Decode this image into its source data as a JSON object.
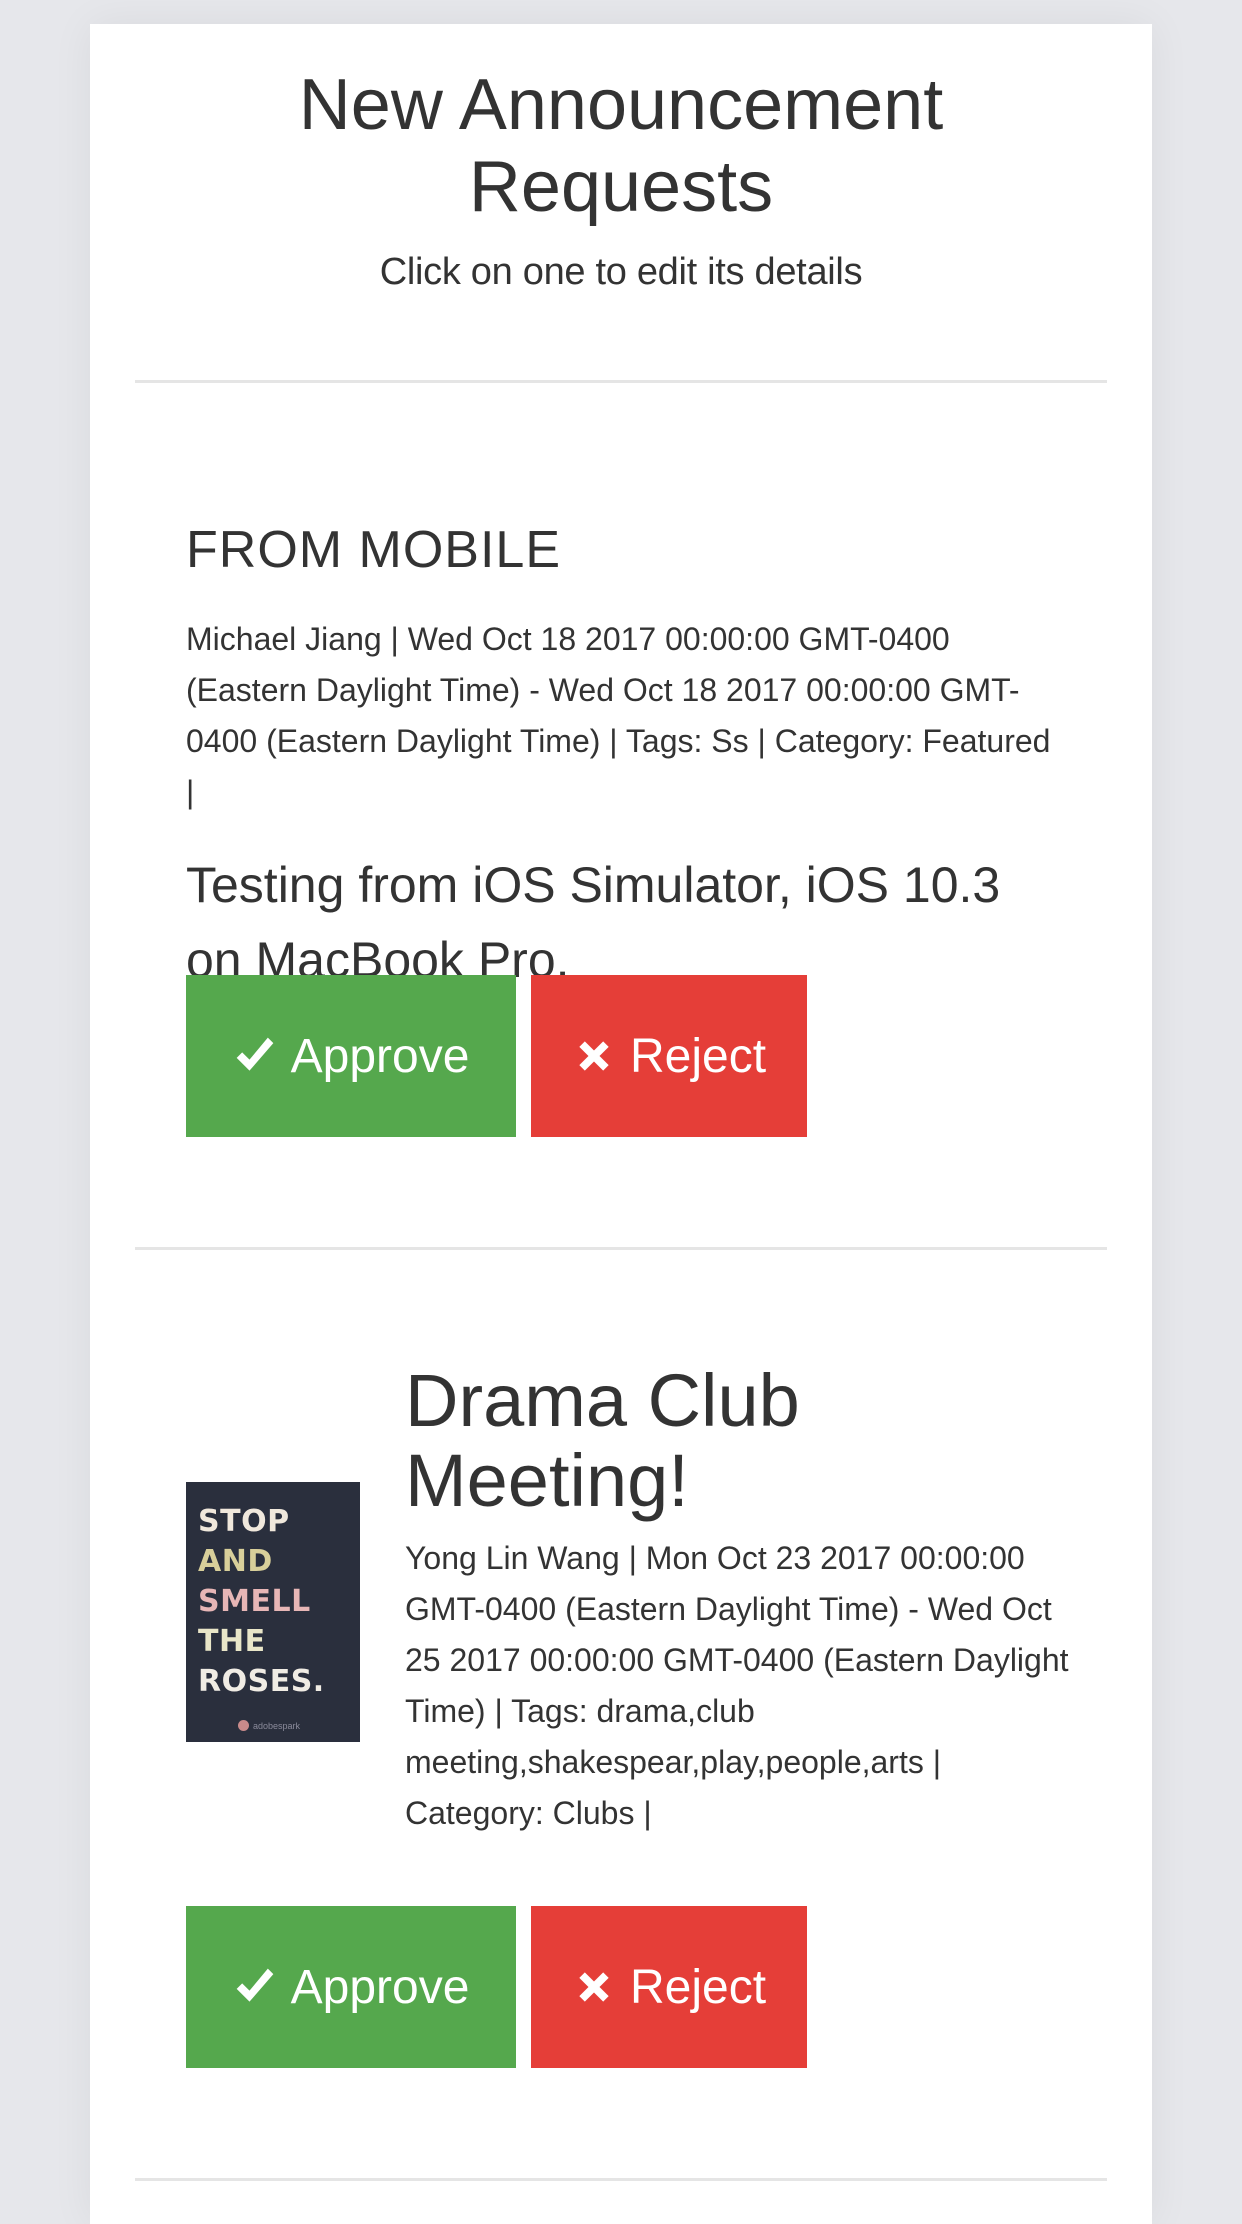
{
  "header": {
    "title": "New Announcement Requests",
    "subtitle": "Click on one to edit its details"
  },
  "requests": [
    {
      "title": "FROM MOBILE",
      "meta": "Michael Jiang | Wed Oct 18 2017 00:00:00 GMT-0400 (Eastern Daylight Time) - Wed Oct 18 2017 00:00:00 GMT-0400 (Eastern Daylight Time) | Tags: Ss | Category: Featured |",
      "body": "Testing from iOS Simulator, iOS 10.3 on MacBook Pro.",
      "approve_label": "Approve",
      "reject_label": "Reject"
    },
    {
      "title": "Drama Club Meeting!",
      "meta": "Yong Lin Wang | Mon Oct 23 2017 00:00:00 GMT-0400 (Eastern Daylight Time) - Wed Oct 25 2017 00:00:00 GMT-0400 (Eastern Daylight Time) | Tags: drama,club meeting,shakespear,play,people,arts | Category: Clubs |",
      "image_text": [
        "STOP",
        "AND",
        "SMELL",
        "THE",
        "ROSES."
      ],
      "image_logo": "adobespark",
      "approve_label": "Approve",
      "reject_label": "Reject"
    }
  ],
  "colors": {
    "approve": "#55a84d",
    "reject": "#e53e38",
    "background": "#e6e7eb",
    "card": "#ffffff"
  },
  "icons": {
    "approve": "check-icon",
    "reject": "close-icon"
  }
}
